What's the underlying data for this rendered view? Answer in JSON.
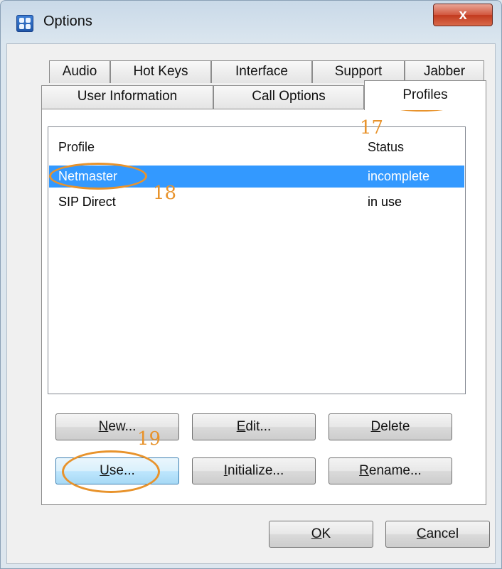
{
  "window": {
    "title": "Options",
    "close_label": "x"
  },
  "tabs_row1": [
    {
      "label": "Audio"
    },
    {
      "label": "Hot Keys"
    },
    {
      "label": "Interface"
    },
    {
      "label": "Support"
    },
    {
      "label": "Jabber"
    }
  ],
  "tabs_row2": [
    {
      "label": "User Information"
    },
    {
      "label": "Call Options"
    },
    {
      "label": "Profiles"
    }
  ],
  "profiles": {
    "columns": {
      "profile": "Profile",
      "status": "Status"
    },
    "rows": [
      {
        "name": "Netmaster",
        "status": "incomplete",
        "selected": true
      },
      {
        "name": "SIP Direct",
        "status": "in use",
        "selected": false
      }
    ]
  },
  "buttons": {
    "new": {
      "mn": "N",
      "rest": "ew..."
    },
    "edit": {
      "mn": "E",
      "rest": "dit..."
    },
    "delete": {
      "mn": "D",
      "rest": "elete"
    },
    "use": {
      "mn": "U",
      "rest": "se..."
    },
    "initialize": {
      "mn": "I",
      "rest": "nitialize..."
    },
    "rename": {
      "mn": "R",
      "rest": "ename..."
    },
    "ok": {
      "mn": "O",
      "rest": "K"
    },
    "cancel": {
      "mn": "C",
      "rest": "ancel"
    }
  },
  "annotations": [
    "17",
    "18",
    "19"
  ],
  "colors": {
    "selection": "#3399ff",
    "annotation": "#e8932c",
    "close": "#c94b30"
  }
}
